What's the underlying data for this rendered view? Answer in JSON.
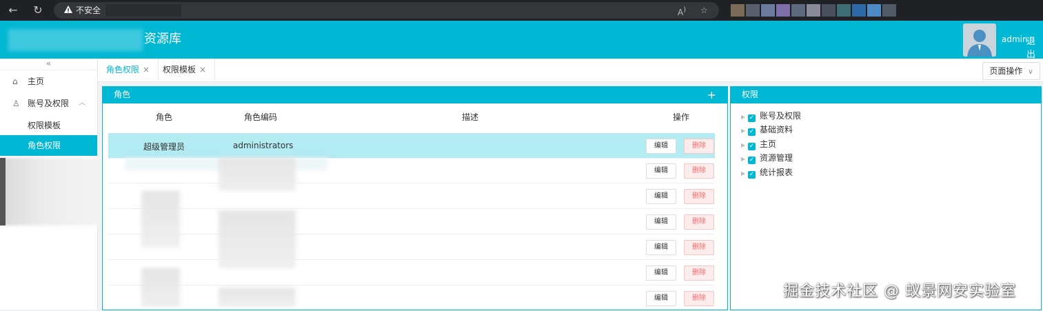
{
  "browser": {
    "security_label": "不安全",
    "icons": [
      "back-icon",
      "reload-icon",
      "warning-icon",
      "read-aloud-icon",
      "favorite-icon"
    ],
    "reader_label": "A⁰"
  },
  "header": {
    "title": "资源库",
    "user": "admin",
    "logout": "退出"
  },
  "sidebar": {
    "collapse": "«",
    "items": [
      {
        "label": "主页",
        "icon": "home-icon"
      },
      {
        "label": "账号及权限",
        "icon": "user-icon"
      },
      {
        "label": "权限模板"
      },
      {
        "label": "角色权限"
      }
    ]
  },
  "tabs": [
    {
      "label": "角色权限",
      "close": "×"
    },
    {
      "label": "权限模板",
      "close": "×"
    }
  ],
  "page_ops": "页面操作",
  "roles_panel": {
    "title": "角色",
    "add": "+",
    "columns": [
      "角色",
      "角色编码",
      "描述",
      "操作"
    ],
    "rows": [
      {
        "role": "超级管理员",
        "code": "administrators",
        "desc": ""
      }
    ],
    "edit_label": "编辑",
    "delete_label": "删除"
  },
  "perm_panel": {
    "title": "权限",
    "items": [
      "账号及权限",
      "基础资料",
      "主页",
      "资源管理",
      "统计报表"
    ]
  },
  "watermark": "掘金技术社区 @ 蚁景网安实验室",
  "colors": {
    "accent": "#00b8d4",
    "selected_row": "#b2ebf2",
    "danger": "#f56c6c"
  }
}
